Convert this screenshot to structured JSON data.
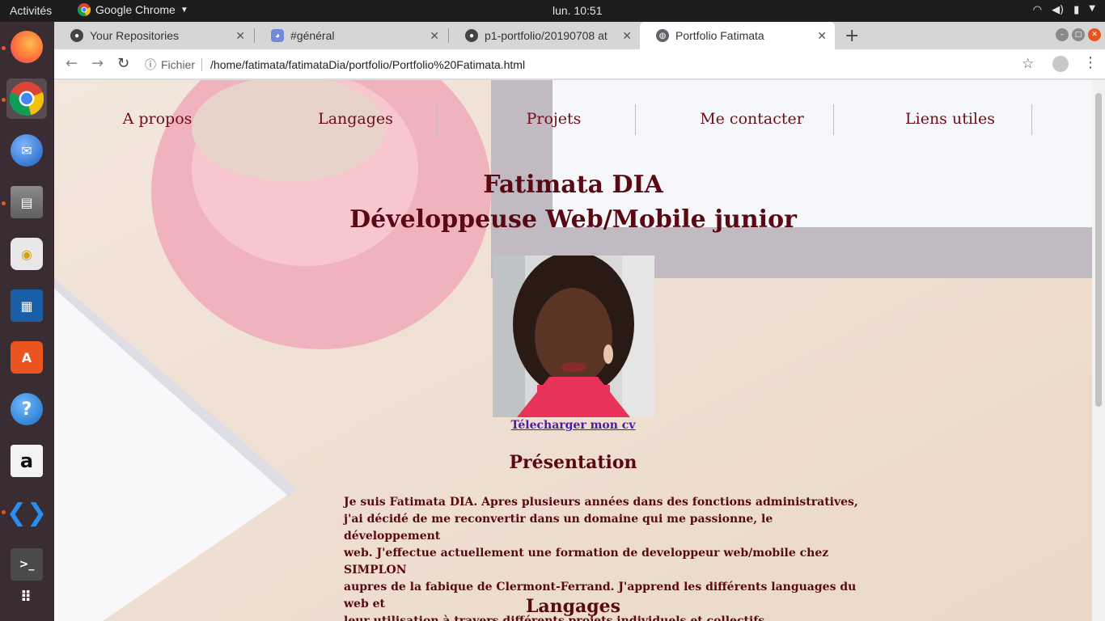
{
  "topbar": {
    "activities": "Activités",
    "app_name": "Google Chrome",
    "clock": "lun. 10:51"
  },
  "dock": {
    "items": [
      "firefox-icon",
      "chrome-icon",
      "thunderbird-icon",
      "files-icon",
      "rhythmbox-icon",
      "libreoffice-impress-icon",
      "software-icon",
      "help-icon",
      "amazon-icon",
      "vscode-icon",
      "terminal-icon",
      "apps-grid-icon"
    ]
  },
  "tabs": [
    {
      "title": "Your Repositories",
      "favicon": "github-icon"
    },
    {
      "title": "#général",
      "favicon": "discord-icon"
    },
    {
      "title": "p1-portfolio/20190708 at",
      "favicon": "github-icon"
    },
    {
      "title": "Portfolio Fatimata",
      "favicon": "globe-icon"
    }
  ],
  "omnibox": {
    "scheme_label": "Fichier",
    "url": "/home/fatimata/fatimataDia/portfolio/Portfolio%20Fatimata.html"
  },
  "page": {
    "nav": [
      "A propos",
      "Langages",
      "Projets",
      "Me contacter",
      "Liens utiles"
    ],
    "name": "Fatimata DIA",
    "role": "Développeuse Web/Mobile junior",
    "cv_link": "Télecharger mon cv",
    "presentation_title": "Présentation",
    "presentation_lines": [
      "Je suis Fatimata DIA. Apres plusieurs années dans des fonctions administratives,",
      "j'ai décidé de me reconvertir dans un domaine qui me passionne, le développement",
      "web. J'effectue actuellement une formation de developpeur web/mobile chez SIMPLON",
      "aupres de la fabique de Clermont-Ferrand. J'apprend les différents languages du web et",
      "leur utilisation à travers différents projets individuels et collectifs."
    ],
    "langages_title": "Langages"
  },
  "colors": {
    "accent": "#5a0812",
    "link": "#4a1aa8",
    "ubuntu_orange": "#e95420"
  }
}
